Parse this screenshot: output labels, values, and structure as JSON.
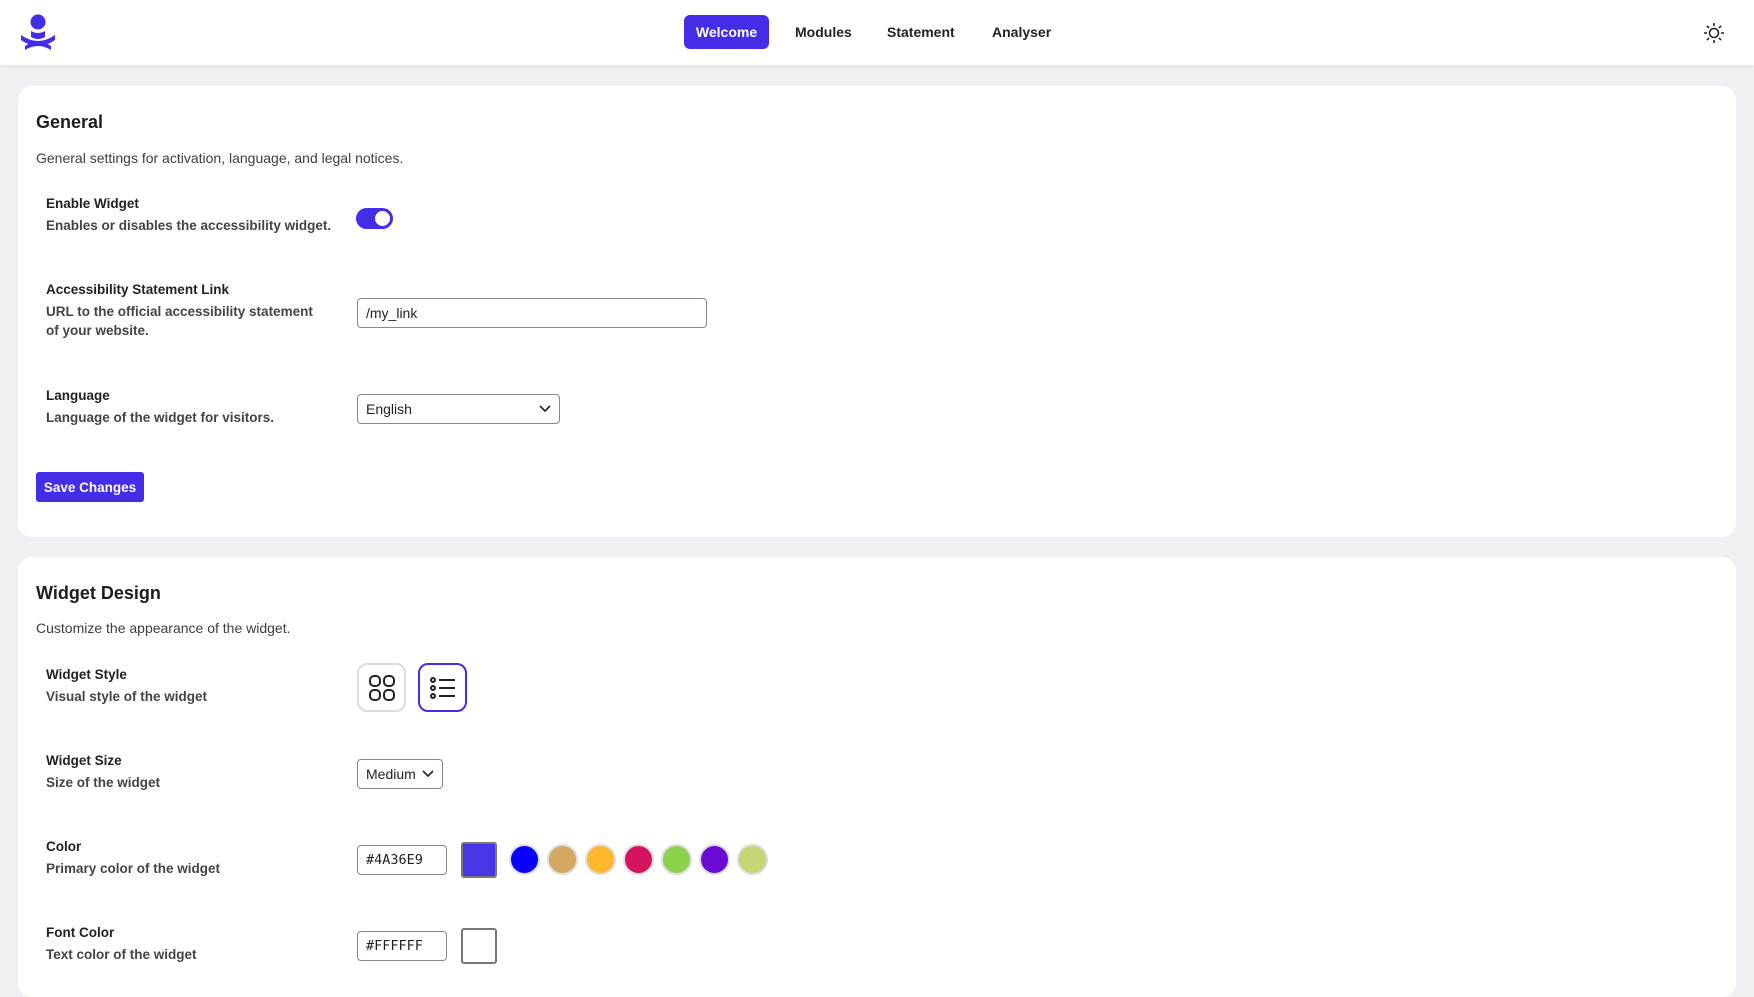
{
  "header": {
    "nav": [
      {
        "label": "Welcome",
        "active": true
      },
      {
        "label": "Modules"
      },
      {
        "label": "Statement"
      },
      {
        "label": "Analyser"
      }
    ],
    "theme_icon": "sun-icon",
    "logo_icon": "person-logo-icon"
  },
  "general": {
    "title": "General",
    "description": "General settings for activation, language, and legal notices.",
    "enable": {
      "label": "Enable Widget",
      "desc": "Enables or disables the accessibility widget.",
      "on": true
    },
    "link": {
      "label": "Accessibility Statement Link",
      "desc": "URL to the official accessibility statement of your website.",
      "value": "/my_link"
    },
    "language": {
      "label": "Language",
      "desc": "Language of the widget for visitors.",
      "value": "English"
    },
    "save_label": "Save Changes"
  },
  "design": {
    "title": "Widget Design",
    "description": "Customize the appearance of the widget.",
    "style": {
      "label": "Widget Style",
      "desc": "Visual style of the widget",
      "options": [
        "grid-icon",
        "list-icon"
      ],
      "selected": "list-icon"
    },
    "size": {
      "label": "Widget Size",
      "desc": "Size of the widget",
      "value": "Medium"
    },
    "color": {
      "label": "Color",
      "desc": "Primary color of the widget",
      "value": "#4A36E9",
      "presets": [
        "#0a00ff",
        "#d4a860",
        "#ffb82e",
        "#d4145f",
        "#8dd24c",
        "#6a0bd4",
        "#c9d474"
      ]
    },
    "font_color": {
      "label": "Font Color",
      "desc": "Text color of the widget",
      "value": "#FFFFFF"
    }
  }
}
